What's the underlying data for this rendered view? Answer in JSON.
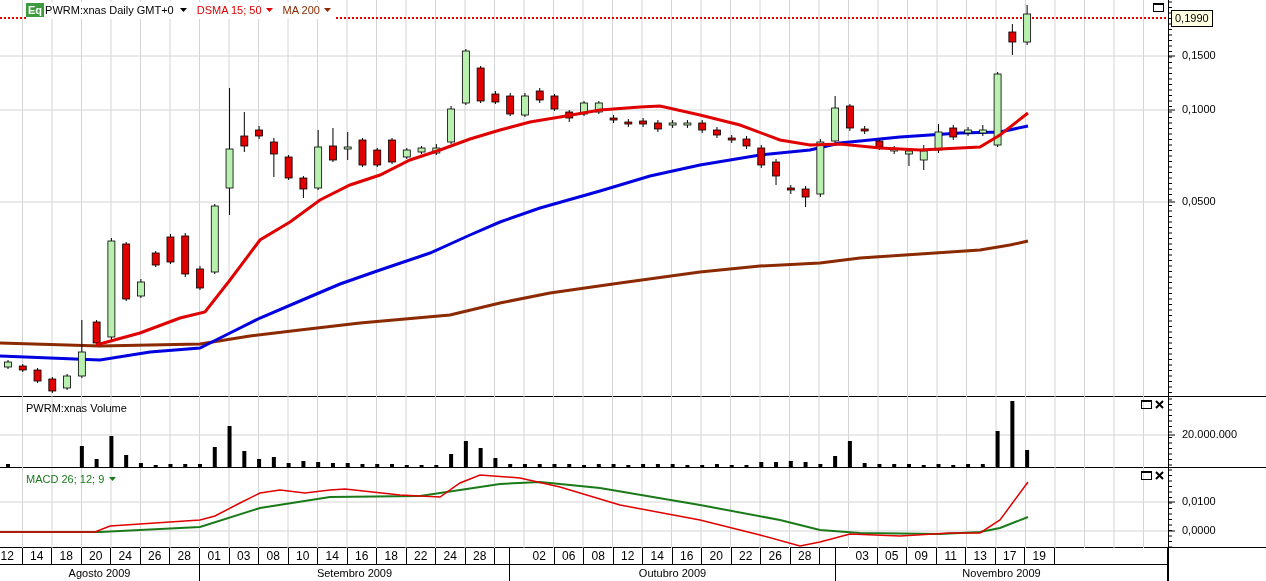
{
  "header": {
    "badge": "Eq",
    "symbol": "PWRM:xnas Daily GMT+0",
    "indicators": [
      {
        "label": "DSMA 15; 50",
        "color": "#e00000"
      },
      {
        "label": "MA 200",
        "color": "#8b2a00"
      }
    ]
  },
  "price_panel": {
    "last_price": "0,1990",
    "axis_labels": [
      "0,1500",
      "0,1000",
      "0,0500"
    ]
  },
  "volume_panel": {
    "title": "PWRM:xnas Volume",
    "axis_labels": [
      "20.000.000"
    ]
  },
  "macd_panel": {
    "title": "MACD 26; 12; 9",
    "axis_labels": [
      "0,0100",
      "0,0000"
    ]
  },
  "time_axis": {
    "months": [
      {
        "label": "Agosto 2009",
        "days": [
          "12",
          "14",
          "18",
          "20",
          "24",
          "26",
          "28"
        ]
      },
      {
        "label": "Setembro 2009",
        "days": [
          "01",
          "03",
          "08",
          "10",
          "14",
          "16",
          "18",
          "22",
          "24",
          "28"
        ]
      },
      {
        "label": "Outubro 2009",
        "days": [
          "02",
          "06",
          "08",
          "12",
          "14",
          "16",
          "20",
          "22",
          "26",
          "28"
        ]
      },
      {
        "label": "Novembro 2009",
        "days": [
          "03",
          "05",
          "09",
          "11",
          "13",
          "17",
          "19"
        ]
      }
    ]
  }
}
